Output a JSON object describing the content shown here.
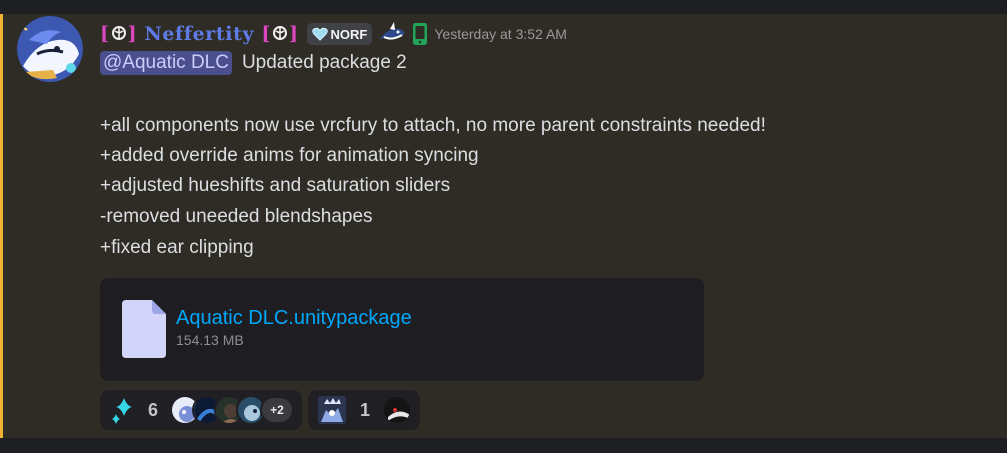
{
  "message": {
    "author": {
      "display_name": "Neffertity",
      "bracket_left": "[",
      "bracket_right": "]",
      "name_color": "#5f7be8",
      "bracket_color": "#d946c0"
    },
    "tag": {
      "label": "NORF",
      "icon": "heart-icon"
    },
    "timestamp": "Yesterday at 3:52 AM",
    "mention": "@Aquatic DLC",
    "first_line": "Updated package 2",
    "body_lines": [
      "+all components now use vrcfury to attach, no more parent constraints needed!",
      "+added override anims for animation syncing",
      "+adjusted hueshifts and saturation sliders",
      "-removed uneeded blendshapes",
      "+fixed ear clipping"
    ],
    "accent_color": "#f0b232"
  },
  "attachment": {
    "file_name": "Aquatic DLC.unitypackage",
    "file_size": "154.13 MB",
    "icon": "file-icon",
    "link_color": "#00a8fc"
  },
  "reactions": [
    {
      "emoji": "sparkle-emoji",
      "count": "6",
      "more": "+2"
    },
    {
      "emoji": "crowned-avatar-emoji",
      "count": "1"
    }
  ]
}
